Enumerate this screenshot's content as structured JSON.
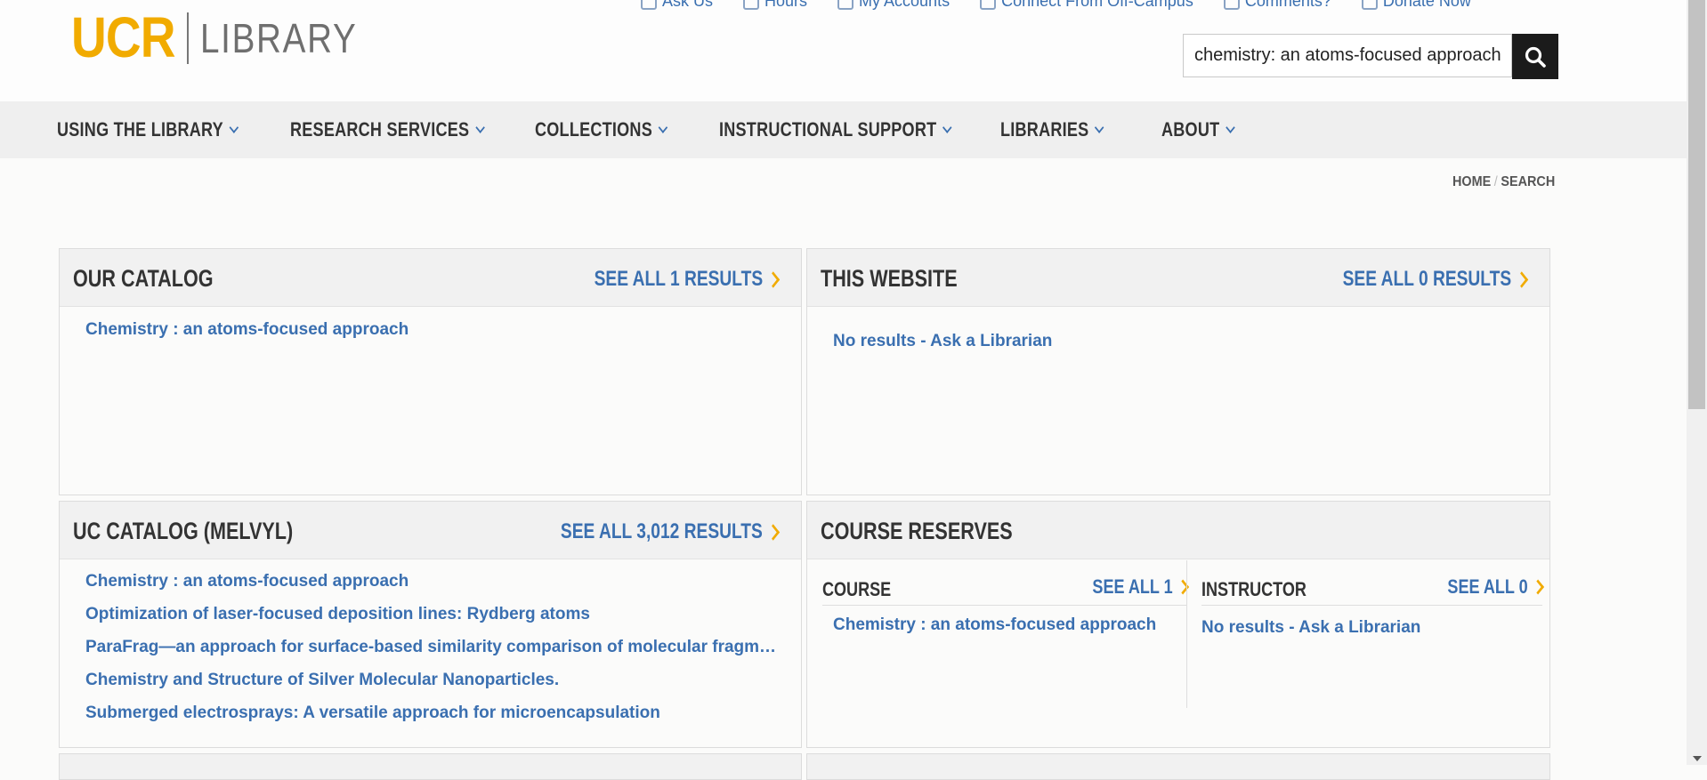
{
  "header": {
    "logo_ucr": "UCR",
    "logo_library": "LIBRARY",
    "utility_links": [
      "Ask Us",
      "Hours",
      "My Accounts",
      "Connect From Off-Campus",
      "Comments?",
      "Donate Now"
    ],
    "search_value": "chemistry: an atoms-focused approach"
  },
  "nav": {
    "items": [
      "USING THE LIBRARY",
      "RESEARCH SERVICES",
      "COLLECTIONS",
      "INSTRUCTIONAL SUPPORT",
      "LIBRARIES",
      "ABOUT"
    ]
  },
  "breadcrumb": {
    "home": "HOME",
    "sep": "/",
    "current": "SEARCH"
  },
  "panels": {
    "our_catalog": {
      "title": "OUR CATALOG",
      "see_all": "SEE ALL 1 RESULTS",
      "results": [
        "Chemistry : an atoms-focused approach"
      ]
    },
    "this_website": {
      "title": "THIS WEBSITE",
      "see_all": "SEE ALL 0 RESULTS",
      "results": [
        "No results - Ask a Librarian"
      ]
    },
    "uc_catalog": {
      "title": "UC CATALOG (MELVYL)",
      "see_all": "SEE ALL 3,012 RESULTS",
      "results": [
        "Chemistry : an atoms-focused approach",
        "Optimization of laser-focused deposition lines: Rydberg atoms",
        "ParaFrag—an approach for surface-based similarity comparison of molecular fragm…",
        "Chemistry and Structure of Silver Molecular Nanoparticles.",
        "Submerged electrosprays: A versatile approach for microencapsulation"
      ]
    },
    "course_reserves": {
      "title": "COURSE RESERVES",
      "course": {
        "label": "COURSE",
        "see_all": "SEE ALL 1",
        "results": [
          "Chemistry : an atoms-focused approach"
        ]
      },
      "instructor": {
        "label": "INSTRUCTOR",
        "see_all": "SEE ALL 0",
        "results": [
          "No results - Ask a Librarian"
        ]
      }
    }
  },
  "colors": {
    "brand_gold": "#f1ab00",
    "link_blue": "#3a6fb0",
    "nav_bg": "#efefef",
    "dark": "#1b1b1b"
  }
}
